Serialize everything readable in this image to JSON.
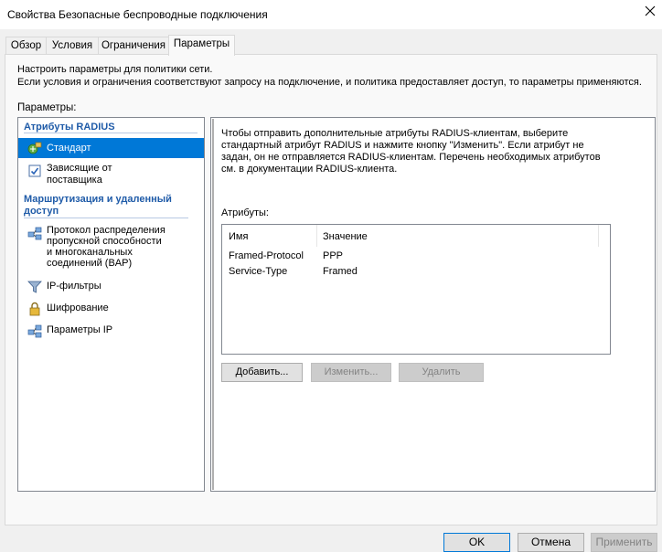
{
  "window": {
    "title": "Свойства Безопасные беспроводные подключения"
  },
  "tabs": [
    {
      "label": "Обзор"
    },
    {
      "label": "Условия"
    },
    {
      "label": "Ограничения"
    },
    {
      "label": "Параметры"
    }
  ],
  "intro": {
    "line1": "Настроить параметры для политики сети.",
    "line2": "Если условия и ограничения соответствуют запросу на подключение, и политика предоставляет доступ, то параметры применяются."
  },
  "settings_label": "Параметры:",
  "nav": {
    "group1": "Атрибуты RADIUS",
    "item_standard": "Стандарт",
    "item_vendor_l1": "Зависящие от",
    "item_vendor_l2": "поставщика",
    "group2_l1": "Маршрутизация и удаленный",
    "group2_l2": "доступ",
    "item_bap_l1": "Протокол распределения",
    "item_bap_l2": "пропускной способности",
    "item_bap_l3": "и многоканальных",
    "item_bap_l4": "соединений (BAP)",
    "item_ipfilters": "IP-фильтры",
    "item_encryption": "Шифрование",
    "item_ipsettings": "Параметры IP"
  },
  "description": {
    "line1": "Чтобы отправить дополнительные атрибуты RADIUS-клиентам, выберите",
    "line2": "стандартный атрибут RADIUS и нажмите кнопку \"Изменить\". Если атрибут не",
    "line3": "задан, он не отправляется RADIUS-клиентам. Перечень необходимых атрибутов",
    "line4": "см. в документации RADIUS-клиента."
  },
  "attributes": {
    "label": "Атрибуты:",
    "columns": {
      "name": "Имя",
      "value": "Значение"
    },
    "rows": [
      {
        "name": "Framed-Protocol",
        "value": "PPP"
      },
      {
        "name": "Service-Type",
        "value": "Framed"
      }
    ]
  },
  "actions": {
    "add": "Добавить...",
    "edit": "Изменить...",
    "remove": "Удалить"
  },
  "footer": {
    "ok": "OK",
    "cancel": "Отмена",
    "apply": "Применить"
  },
  "colors": {
    "accent": "#0078d7",
    "group_header": "#1f5ba8",
    "background": "#f0f0f0"
  }
}
